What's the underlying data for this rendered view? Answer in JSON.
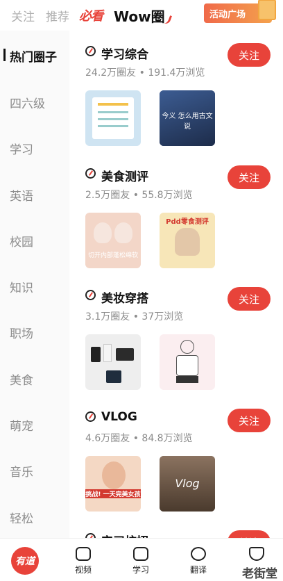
{
  "top_tabs": {
    "follow": "关注",
    "recommend": "推荐",
    "logo_tab": "必看",
    "active": "Wow圈",
    "activity_button": "活动广场"
  },
  "sidebar": {
    "items": [
      {
        "label": "热门圈子",
        "active": true
      },
      {
        "label": "四六级"
      },
      {
        "label": "学习"
      },
      {
        "label": "英语"
      },
      {
        "label": "校园"
      },
      {
        "label": "知识"
      },
      {
        "label": "职场"
      },
      {
        "label": "美食"
      },
      {
        "label": "萌宠"
      },
      {
        "label": "音乐"
      },
      {
        "label": "轻松"
      }
    ]
  },
  "groups": [
    {
      "title": "学习综合",
      "stats": "24.2万圈友 • 191.4万浏览",
      "follow": "关注",
      "thumb2_caption": "今义 怎么用古文说"
    },
    {
      "title": "美食测评",
      "stats": "2.5万圈友 • 55.8万浏览",
      "follow": "关注",
      "thumb1_caption": "切开内部蓬松绵软",
      "thumb2_caption": "Pdd零食测评"
    },
    {
      "title": "美妆穿搭",
      "stats": "3.1万圈友 • 37万浏览",
      "follow": "关注"
    },
    {
      "title": "VLOG",
      "stats": "4.6万圈友 • 84.8万浏览",
      "follow": "关注",
      "thumb1_caption": "挑战! 一天完美女孩",
      "thumb2_caption": "Vlog"
    },
    {
      "title": "实习校招",
      "follow": "关注"
    }
  ],
  "bottom_nav": {
    "brand": "有道",
    "items": [
      {
        "label": "视频",
        "icon": "video-camera-icon"
      },
      {
        "label": "学习",
        "icon": "play-icon"
      },
      {
        "label": "翻译",
        "icon": "translate-icon"
      },
      {
        "label": "",
        "icon": "shield-v-icon"
      }
    ],
    "watermark": "老街堂"
  },
  "colors": {
    "accent": "#e8433a",
    "muted": "#8c8c8c"
  }
}
